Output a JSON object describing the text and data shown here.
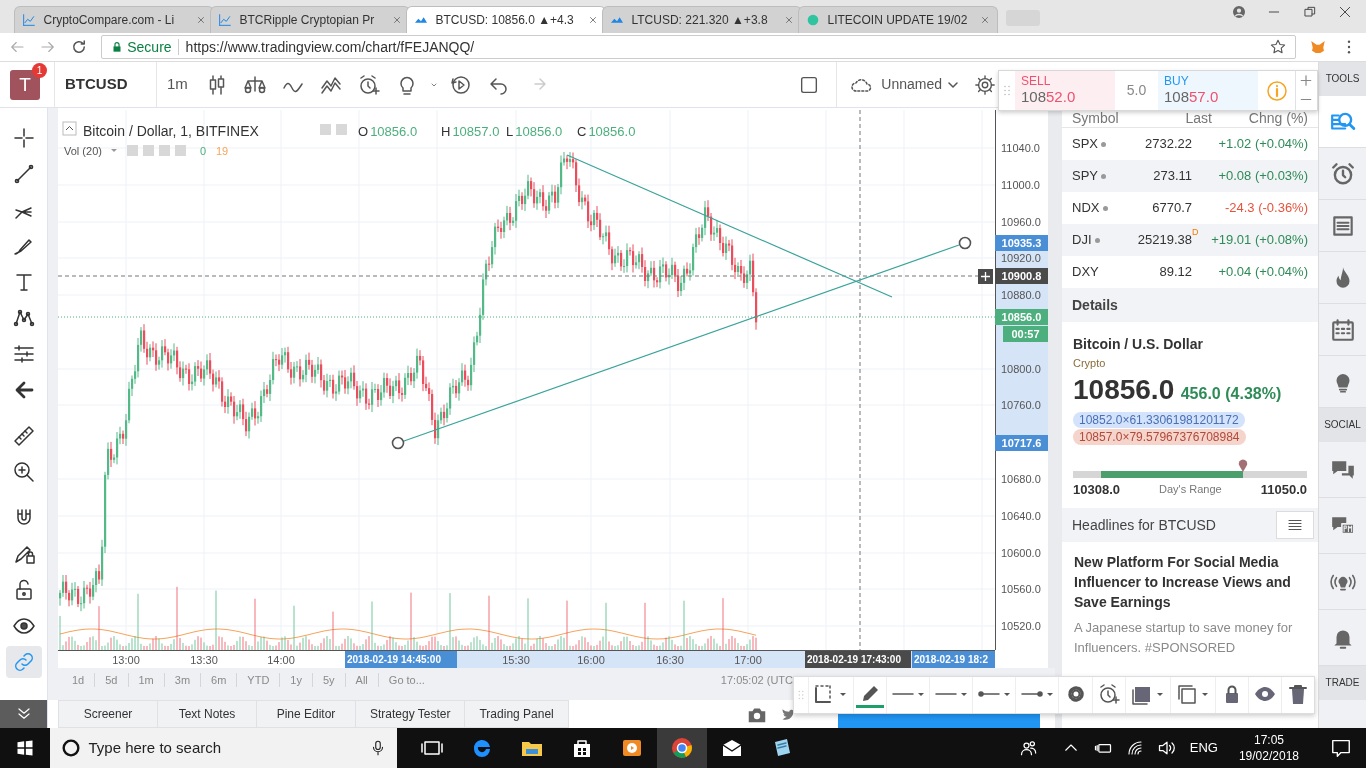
{
  "browser": {
    "tabs": [
      {
        "title": "CryptoCompare.com - Li",
        "selected": false
      },
      {
        "title": "BTCRipple Cryptopian Pr",
        "selected": false
      },
      {
        "title": "BTCUSD: 10856.0 ▲+4.3",
        "selected": true
      },
      {
        "title": "LTCUSD: 221.320 ▲+3.8",
        "selected": false
      },
      {
        "title": "LITECOIN UPDATE 19/02",
        "selected": false
      }
    ],
    "secure_label": "Secure",
    "url": "https://www.tradingview.com/chart/fFEJANQQ/"
  },
  "header": {
    "avatar": "T",
    "notifications": "1",
    "symbol": "BTCUSD",
    "interval": "1m",
    "layout_name": "Unnamed"
  },
  "trade": {
    "sell_label": "SELL",
    "sell_price": [
      "108",
      "52.0"
    ],
    "spread": "5.0",
    "buy_label": "BUY",
    "buy_price": [
      "108",
      "57.0"
    ]
  },
  "left_tools": [
    {
      "selected": false
    },
    {
      "selected": false
    },
    {
      "selected": false
    },
    {
      "selected": false
    },
    {
      "selected": false
    },
    {
      "selected": false
    },
    {
      "selected": false
    },
    {
      "selected": false
    },
    {
      "selected": false
    },
    {
      "selected": false
    },
    {
      "selected": false
    },
    {
      "selected": false
    },
    {
      "selected": false
    },
    {
      "selected": false
    },
    {
      "selected": true
    }
  ],
  "chart": {
    "title": "Bitcoin / Dollar, 1, BITFINEX",
    "ohlc": [
      {
        "label": "O",
        "value": "10856.0"
      },
      {
        "label": "H",
        "value": "10857.0"
      },
      {
        "label": "L",
        "value": "10856.0"
      },
      {
        "label": "C",
        "value": "10856.0"
      }
    ],
    "volume_label": "Vol (20)",
    "volume_values": [
      "0",
      "19"
    ],
    "price_ticks": [
      "11040.0",
      "11000.0",
      "10960.0",
      "10920.0",
      "10880.0",
      "10800.0",
      "10760.0",
      "10680.0",
      "10640.0",
      "10600.0",
      "10560.0",
      "10520.0"
    ],
    "price_labels": [
      {
        "kind": "alert",
        "text": "10935.3"
      },
      {
        "kind": "crosshair",
        "text": "10900.8"
      },
      {
        "kind": "last",
        "text": "10856.0"
      },
      {
        "kind": "countdown",
        "text": "00:57"
      },
      {
        "kind": "alert",
        "text": "10717.6"
      }
    ],
    "time_ticks": [
      "13:00",
      "13:30",
      "14:00",
      "15:30",
      "16:00",
      "16:30",
      "17:00"
    ],
    "time_labels": [
      {
        "kind": "alert",
        "text": "2018-02-19 14:45:00"
      },
      {
        "kind": "crosshair",
        "text": "2018-02-19 17:43:00"
      },
      {
        "kind": "alert",
        "text": "2018-02-19 18:2"
      }
    ]
  },
  "range_buttons": [
    "1d",
    "5d",
    "1m",
    "3m",
    "6m",
    "YTD",
    "1y",
    "5y",
    "All",
    "Go to..."
  ],
  "clock": "17:05:02 (UTC",
  "bottom_tabs": [
    "Screener",
    "Text Notes",
    "Pine Editor",
    "Strategy Tester",
    "Trading Panel"
  ],
  "watchlist": {
    "columns": [
      "Symbol",
      "Last",
      "Chng (%)"
    ],
    "rows": [
      {
        "symbol": "SPX",
        "dot": true,
        "last": "2732.22",
        "flag": "",
        "change": "+1.02 (+0.04%)",
        "rising": true
      },
      {
        "symbol": "SPY",
        "dot": true,
        "last": "273.11",
        "flag": "",
        "change": "+0.08 (+0.03%)",
        "rising": true
      },
      {
        "symbol": "NDX",
        "dot": true,
        "last": "6770.7",
        "flag": "",
        "change": "-24.3 (-0.36%)",
        "rising": false
      },
      {
        "symbol": "DJI",
        "dot": true,
        "last": "25219.38",
        "flag": "D",
        "change": "+19.01 (+0.08%)",
        "rising": true
      },
      {
        "symbol": "DXY",
        "dot": false,
        "last": "89.12",
        "flag": "",
        "change": "+0.04 (+0.04%)",
        "rising": true
      }
    ]
  },
  "details": {
    "heading": "Details",
    "name": "Bitcoin / U.S. Dollar",
    "type": "Crypto",
    "price": "10856.0",
    "change": "456.0 (4.38%)",
    "bid": "10852.0×61.33061981201172",
    "ask": "10857.0×79.57967376708984",
    "range": {
      "low": "10308.0",
      "label": "Day's Range",
      "high": "11050.0",
      "level": 0.69
    }
  },
  "headlines": {
    "title": "Headlines for BTCUSD",
    "items": [
      {
        "title": "New Platform For Social Media Influencer to Increase Views and Save Earnings",
        "summary": "A Japanese startup to save money for Influencers. #SPONSORED"
      }
    ]
  },
  "side_strip": {
    "sections": [
      {
        "label": "TOOLS",
        "items": [
          {
            "selected": true
          },
          {
            "selected": false
          },
          {
            "selected": false
          },
          {
            "selected": false
          },
          {
            "selected": false
          },
          {
            "selected": false
          }
        ]
      },
      {
        "label": "SOCIAL",
        "items": [
          {
            "selected": false
          },
          {
            "selected": false
          },
          {
            "selected": false
          },
          {
            "selected": false
          }
        ]
      },
      {
        "label": "TRADE"
      }
    ]
  },
  "drawing_toolbar": {
    "tools": [
      {
        "selected": false
      },
      {
        "selected": true
      },
      {
        "selected": false
      },
      {
        "selected": false
      },
      {
        "selected": false
      },
      {
        "selected": false
      },
      {
        "selected": false
      },
      {
        "selected": false
      },
      {
        "selected": false
      },
      {
        "selected": false
      },
      {
        "selected": false
      },
      {
        "selected": false
      },
      {
        "selected": false
      }
    ]
  },
  "taskbar": {
    "search_placeholder": "Type here to search",
    "apps": [
      {
        "selected": false
      },
      {
        "selected": false
      },
      {
        "selected": false
      },
      {
        "selected": false
      },
      {
        "selected": false
      },
      {
        "selected": true
      },
      {
        "selected": false
      },
      {
        "selected": false
      }
    ],
    "language": "ENG",
    "time": "17:05",
    "date": "19/02/2018"
  }
}
